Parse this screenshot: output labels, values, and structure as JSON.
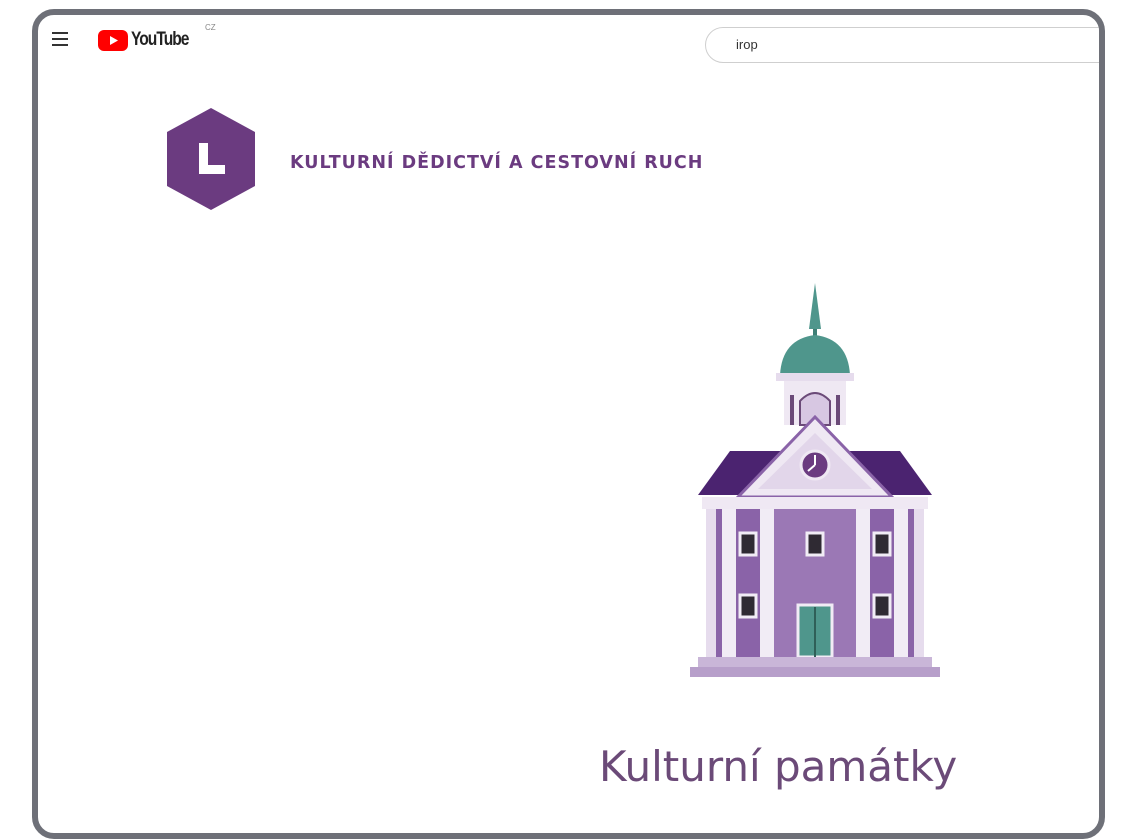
{
  "youtube": {
    "logo_text": "YouTube",
    "region": "CZ",
    "search_value": "irop"
  },
  "video": {
    "badge_letter": "L",
    "category_title": "KULTURNÍ DĚDICTVÍ A CESTOVNÍ RUCH",
    "subtitle": "Kulturní památky",
    "illustration": "historic-town-hall-icon"
  },
  "colors": {
    "brand_purple": "#6b3b80",
    "roof_purple": "#4b2370",
    "wall_purple": "#8a63a8",
    "dome_teal": "#4f968c",
    "youtube_red": "#ff0000"
  }
}
